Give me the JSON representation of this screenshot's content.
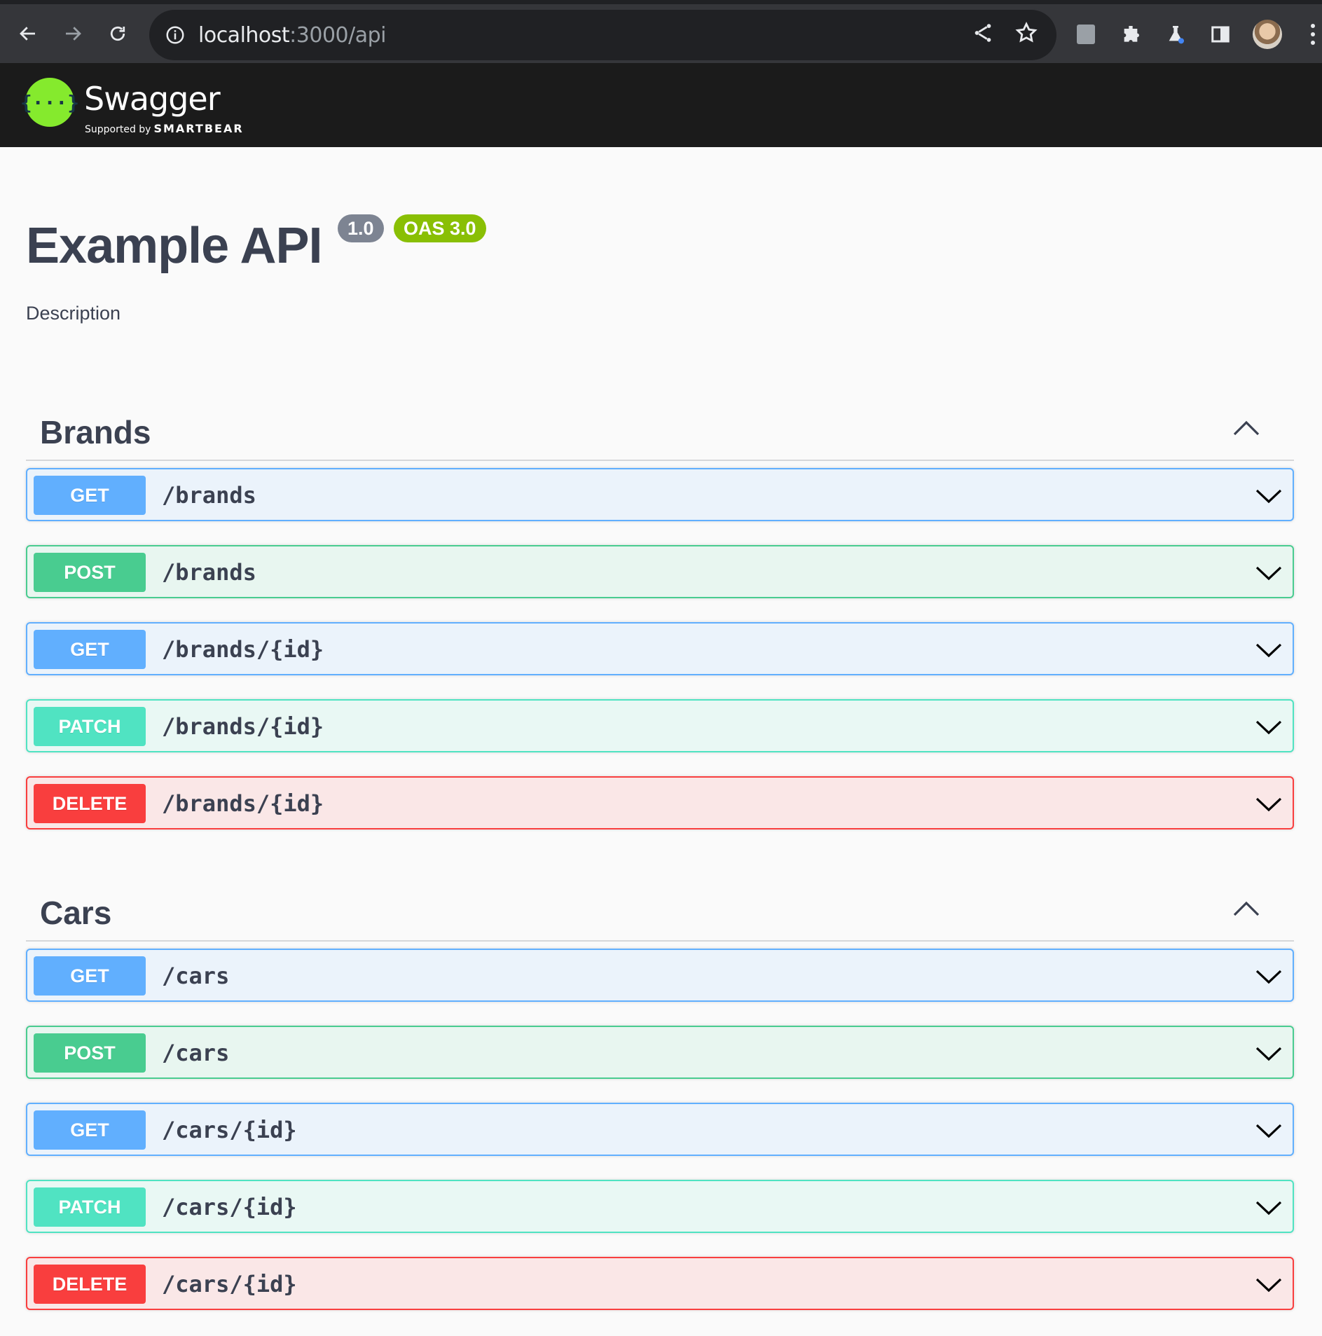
{
  "browser": {
    "url_host": "localhost",
    "url_rest": ":3000/api"
  },
  "topbar": {
    "logo_glyph": "{···}",
    "logo_text": "Swagger",
    "supported_by": "Supported by",
    "smartbear": "SMARTBEAR"
  },
  "info": {
    "title": "Example API",
    "version": "1.0",
    "oas": "OAS 3.0",
    "description": "Description"
  },
  "tags": [
    {
      "name": "Brands",
      "operations": [
        {
          "method": "GET",
          "path": "/brands",
          "kind": "get"
        },
        {
          "method": "POST",
          "path": "/brands",
          "kind": "post"
        },
        {
          "method": "GET",
          "path": "/brands/{id}",
          "kind": "get"
        },
        {
          "method": "PATCH",
          "path": "/brands/{id}",
          "kind": "patch"
        },
        {
          "method": "DELETE",
          "path": "/brands/{id}",
          "kind": "delete"
        }
      ]
    },
    {
      "name": "Cars",
      "operations": [
        {
          "method": "GET",
          "path": "/cars",
          "kind": "get"
        },
        {
          "method": "POST",
          "path": "/cars",
          "kind": "post"
        },
        {
          "method": "GET",
          "path": "/cars/{id}",
          "kind": "get"
        },
        {
          "method": "PATCH",
          "path": "/cars/{id}",
          "kind": "patch"
        },
        {
          "method": "DELETE",
          "path": "/cars/{id}",
          "kind": "delete"
        }
      ]
    }
  ],
  "colors": {
    "get": "#61affe",
    "post": "#49cc90",
    "patch": "#50e3c2",
    "delete": "#f93e3e",
    "swagger_green": "#85ea2d"
  }
}
